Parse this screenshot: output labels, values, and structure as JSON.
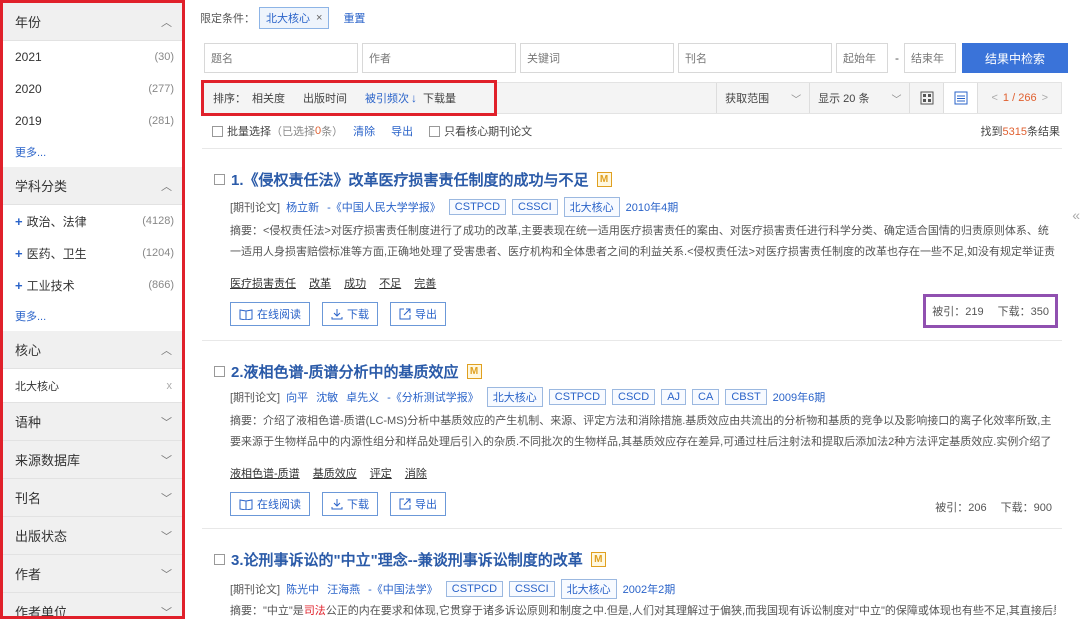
{
  "sidebar": {
    "year_header": "年份",
    "years": [
      {
        "label": "2021",
        "count": "(30)"
      },
      {
        "label": "2020",
        "count": "(277)"
      },
      {
        "label": "2019",
        "count": "(281)"
      }
    ],
    "more1": "更多...",
    "subject_header": "学科分类",
    "subjects": [
      {
        "label": "政治、法律",
        "count": "(4128)"
      },
      {
        "label": "医药、卫生",
        "count": "(1204)"
      },
      {
        "label": "工业技术",
        "count": "(866)"
      }
    ],
    "more2": "更多...",
    "core_header": "核心",
    "core_selected": "北大核心",
    "core_x": "x",
    "collapsed": [
      "语种",
      "来源数据库",
      "刊名",
      "出版状态",
      "作者",
      "作者单位"
    ]
  },
  "filter": {
    "label": "限定条件：",
    "tag": "北大核心",
    "tag_close": "×",
    "reset": "重置"
  },
  "search": {
    "title_ph": "题名",
    "author_ph": "作者",
    "keyword_ph": "关键词",
    "journal_ph": "刊名",
    "start_year_ph": "起始年",
    "dash": "-",
    "end_year_ph": "结束年",
    "button": "结果中检索"
  },
  "toolbar": {
    "sort_label": "排序：",
    "sort_relevance": "相关度",
    "sort_pubtime": "出版时间",
    "sort_cited": "被引频次",
    "sort_arrow": "↓",
    "sort_downloads": "下载量",
    "scope": "获取范围",
    "display": "显示 20 条",
    "page": "1 / 266",
    "page_prev": "<",
    "page_next": ">"
  },
  "batch": {
    "select_label": "批量选择",
    "selected": "（已选择",
    "selected_count": "0",
    "selected_end": "条）",
    "clear": "清除",
    "export": "导出",
    "only_core": "只看核心期刊论文",
    "found_prefix": "找到",
    "found_count": "5315",
    "found_suffix": "条结果"
  },
  "results": [
    {
      "title": "1.《侵权责任法》改革医疗损害责任制度的成功与不足",
      "badge": "M",
      "type": "[期刊论文]",
      "authors": [
        "杨立新"
      ],
      "source": "-《中国人民大学学报》",
      "tags": [
        "CSTPCD",
        "CSSCI",
        "北大核心"
      ],
      "date": "2010年4期",
      "abstract": "摘要：<侵权责任法>对医疗损害责任制度进行了成功的改革,主要表现在统一适用医疗损害责任的案由、对医疗损害责任进行科学分类、确定适合国情的归责原则体系、统一适用人身损害赔偿标准等方面,正确地处理了受害患者、医疗机构和全体患者之间的利益关系.<侵权责任法>对医疗损害责任制度的改革也存在一些不足,如没有规定举证责任...",
      "keywords": [
        "医疗损害责任",
        "改革",
        "成功",
        "不足",
        "完善"
      ],
      "read": "在线阅读",
      "download": "下载",
      "export": "导出",
      "cited": "被引：219",
      "downloads": "下载：350"
    },
    {
      "title": "2.液相色谱-质谱分析中的基质效应",
      "badge": "M",
      "type": "[期刊论文]",
      "authors": [
        "向平",
        "沈敏",
        "卓先义"
      ],
      "source": "-《分析测试学报》",
      "tags": [
        "北大核心",
        "CSTPCD",
        "CSCD",
        "AJ",
        "CA",
        "CBST"
      ],
      "date": "2009年6期",
      "abstract": "摘要：介绍了液相色谱-质谱(LC-MS)分析中基质效应的产生机制、来源、评定方法和消除措施.基质效应由共流出的分析物和基质的竞争以及影响接口的离子化效率所致,主要来源于生物样品中的内源性组分和样品处理后引入的杂质.不同批次的生物样品,其基质效应存在差异,可通过柱后注射法和提取后添加法2种方法评定基质效应.实例介绍了基质...",
      "keywords": [
        "液相色谱-质谱",
        "基质效应",
        "评定",
        "消除"
      ],
      "read": "在线阅读",
      "download": "下载",
      "export": "导出",
      "cited": "被引：206",
      "downloads": "下载：900"
    },
    {
      "title": "3.论刑事诉讼的\"中立\"理念--兼谈刑事诉讼制度的改革",
      "badge": "M",
      "type": "[期刊论文]",
      "authors": [
        "陈光中",
        "汪海燕"
      ],
      "source": "-《中国法学》",
      "tags": [
        "CSTPCD",
        "CSSCI",
        "北大核心"
      ],
      "date": "2002年2期",
      "abstract_pre": "摘要：\"中立\"是",
      "abstract_hl": "司法",
      "abstract_post": "公正的内在要求和体现,它贯穿于诸多诉讼原则和制度之中.但是,人们对其理解过于偏狭,而我国现有诉讼制度对\"中立\"的保障或体现也有些不足,其直接后果"
    }
  ],
  "colors": {
    "accent": "#2a63c9",
    "highlight_red": "#e0202a",
    "highlight_purple": "#9050b0",
    "count_orange": "#e06030"
  }
}
